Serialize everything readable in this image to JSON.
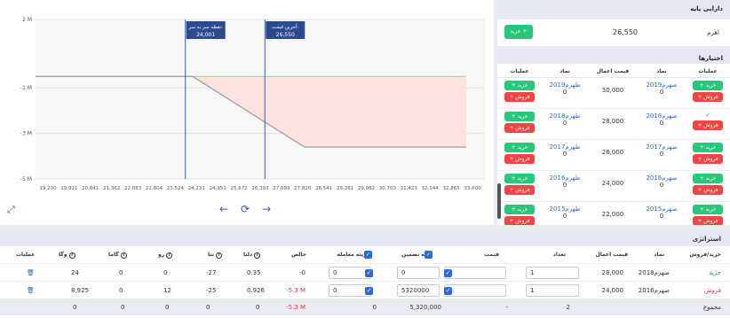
{
  "chart": {
    "y_ticks": [
      "2 M",
      "-1 M",
      "-3 M",
      "-5 M"
    ],
    "x_ticks": [
      "19,200",
      "19,921",
      "20,641",
      "21,362",
      "22,083",
      "22,804",
      "23,524",
      "24,231",
      "24,951",
      "25,672",
      "26,393",
      "27,099",
      "27,820",
      "28,541",
      "29,261",
      "29,982",
      "30,703",
      "31,423",
      "32,144",
      "32,865",
      "33,600"
    ],
    "breakeven_label": "نقطه سر به سر:",
    "breakeven_value": "24,001",
    "last_price_label": "آخرین قیمت:",
    "last_price_value": "26,550"
  },
  "chart_data": {
    "type": "line",
    "x": [
      19200,
      24231,
      27820,
      33600
    ],
    "y": [
      -0.5,
      -0.5,
      -3.6,
      -3.6
    ],
    "ylim": [
      -5,
      2
    ],
    "xlim": [
      19200,
      33600
    ],
    "breakeven": 24001,
    "last_price": 26550,
    "colors": {
      "line": "#999999",
      "loss_fill": "#fde3de",
      "vline": "#3b5ba8"
    }
  },
  "base_asset": {
    "title": "دارایی پایه",
    "label": "اهرم",
    "value": "26,550",
    "buy_label": "خرید +"
  },
  "options": {
    "title": "اختیارها",
    "columns": [
      "عملیات",
      "نماد",
      "قیمت اعمال",
      "نماد",
      "عملیات"
    ],
    "rows": [
      {
        "call": "ضهرم2019",
        "strike": "30,000",
        "put": "طهرم2019",
        "left_buy": true,
        "right_buy": true
      },
      {
        "call": "ضهرم2018",
        "strike": "28,000",
        "put": "طهرم2018",
        "left_buy": true,
        "right_buy": false
      },
      {
        "call": "ضهرم2017",
        "strike": "26,000",
        "put": "طهرم2017",
        "left_buy": true,
        "right_buy": true
      },
      {
        "call": "ضهرم2016",
        "strike": "24,000",
        "put": "طهرم2016",
        "left_buy": true,
        "right_buy": true
      },
      {
        "call": "ضهرم2015",
        "strike": "22,000",
        "put": "طهرم2015",
        "left_buy": true,
        "right_buy": true
      }
    ],
    "buy": "+ خرید",
    "sell": "+ فروش",
    "check": "✓",
    "zero": "0"
  },
  "strategy": {
    "title": "استراتژی",
    "columns": {
      "side": "خرید/فروش",
      "symbol": "نماد",
      "strike": "قیمت اعمال",
      "qty": "تعداد",
      "price": "قیمت",
      "margin": "وجه تضمین",
      "fee": "هزینه معامله",
      "net": "خالص",
      "delta": "دلتا",
      "theta": "تتا",
      "rho": "رو",
      "gamma": "گاما",
      "vega": "وگا",
      "actions": "عملیات"
    },
    "rows": [
      {
        "side": "خرید",
        "symbol": "ضهرم2018",
        "strike": "28,000",
        "qty": "1",
        "price": "0",
        "margin": "0",
        "fee": "0",
        "net": "-0",
        "delta": "0.35",
        "theta": "-27",
        "rho": "0",
        "gamma": "0",
        "vega": "24"
      },
      {
        "side": "فروش",
        "symbol": "ضهرم2016",
        "strike": "24,000",
        "qty": "1",
        "price": "0",
        "margin": "5320000",
        "fee": "0",
        "net": "-5.3 M",
        "delta": "0.926",
        "theta": "-25",
        "rho": "12",
        "gamma": "0",
        "vega": "8,925"
      }
    ],
    "sum": {
      "label": "مجموع",
      "qty": "2",
      "price": "-",
      "margin": "5,320,000",
      "fee": "0",
      "net": "-5.3 M",
      "delta": "0",
      "theta": "0",
      "rho": "0",
      "gamma": "0",
      "vega": "0"
    }
  }
}
